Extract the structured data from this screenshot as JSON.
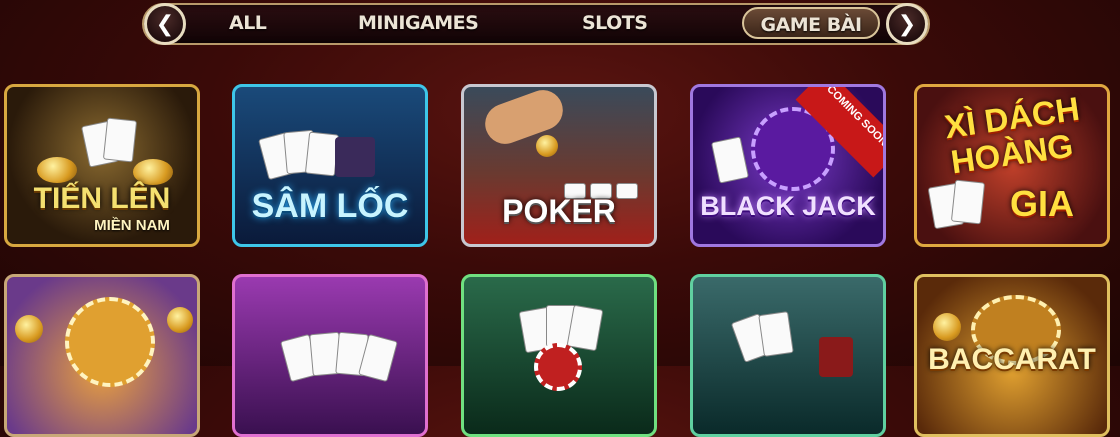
{
  "nav": {
    "tabs": [
      {
        "label": "ALL"
      },
      {
        "label": "MINIGAMES"
      },
      {
        "label": "SLOTS"
      },
      {
        "label": "GAME BÀI",
        "active": true
      }
    ],
    "prev_icon": "chevron-left-icon",
    "next_icon": "chevron-right-icon"
  },
  "games": [
    {
      "title": "TIẾN LÊN",
      "subtitle": "MIỀN NAM"
    },
    {
      "title": "SÂM LỐC"
    },
    {
      "title": "POKER"
    },
    {
      "title": "BLACK JACK",
      "badge": "COMING SOON"
    },
    {
      "title_line1": "XÌ DÁCH",
      "title_line2": "HOÀNG",
      "title_line3": "GIA"
    },
    {
      "title": ""
    },
    {
      "title": ""
    },
    {
      "title": ""
    },
    {
      "title": ""
    },
    {
      "title": "BACCARAT"
    }
  ],
  "colors": {
    "nav_border": "#b89a6a",
    "active_tab": "#6a4a36",
    "coming_soon_ribbon": "#c81818"
  }
}
